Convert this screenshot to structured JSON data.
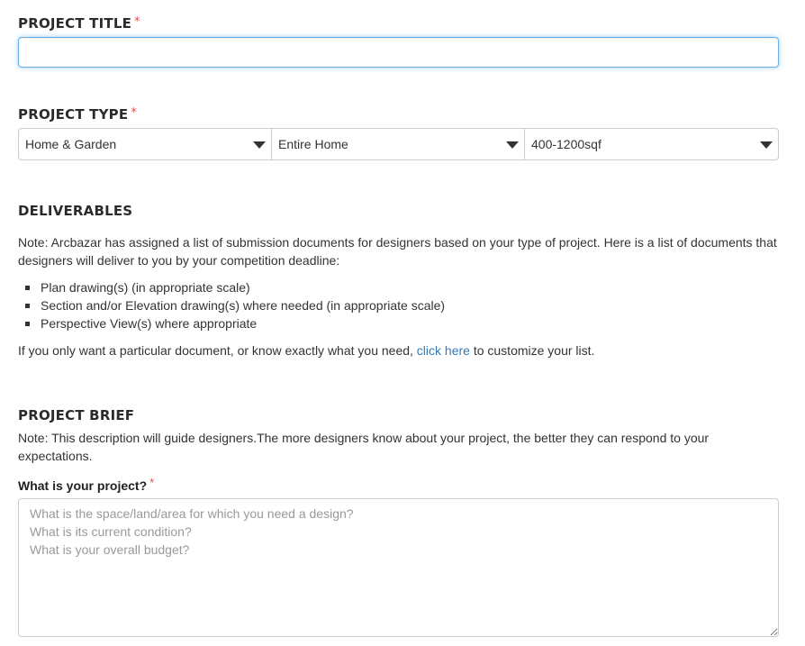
{
  "project_title": {
    "label": "PROJECT TITLE",
    "required_mark": "*",
    "value": ""
  },
  "project_type": {
    "label": "PROJECT TYPE",
    "required_mark": "*",
    "selects": [
      {
        "value": "Home & Garden"
      },
      {
        "value": "Entire Home"
      },
      {
        "value": "400-1200sqf"
      }
    ]
  },
  "deliverables": {
    "heading": "DELIVERABLES",
    "note": "Note: Arcbazar has assigned a list of submission documents for designers based on your type of project. Here is a list of documents that designers will deliver to you by your competition deadline:",
    "items": [
      "Plan drawing(s) (in appropriate scale)",
      "Section and/or Elevation drawing(s) where needed (in appropriate scale)",
      "Perspective View(s) where appropriate"
    ],
    "custom_prefix": "If you only want a particular document, or know exactly what you need,",
    "custom_link": "click here",
    "custom_suffix": "to customize your list."
  },
  "project_brief": {
    "heading": "PROJECT BRIEF",
    "note": "Note: This description will guide designers.The more designers know about your project, the better they can respond to your expectations.",
    "question": "What is your project?",
    "required_mark": "*",
    "placeholder": "What is the space/land/area for which you need a design?\nWhat is its current condition?\nWhat is your overall budget?",
    "value": ""
  },
  "colors": {
    "required": "#d9534f",
    "link": "#337ab7",
    "focus_border": "#66afe9"
  }
}
